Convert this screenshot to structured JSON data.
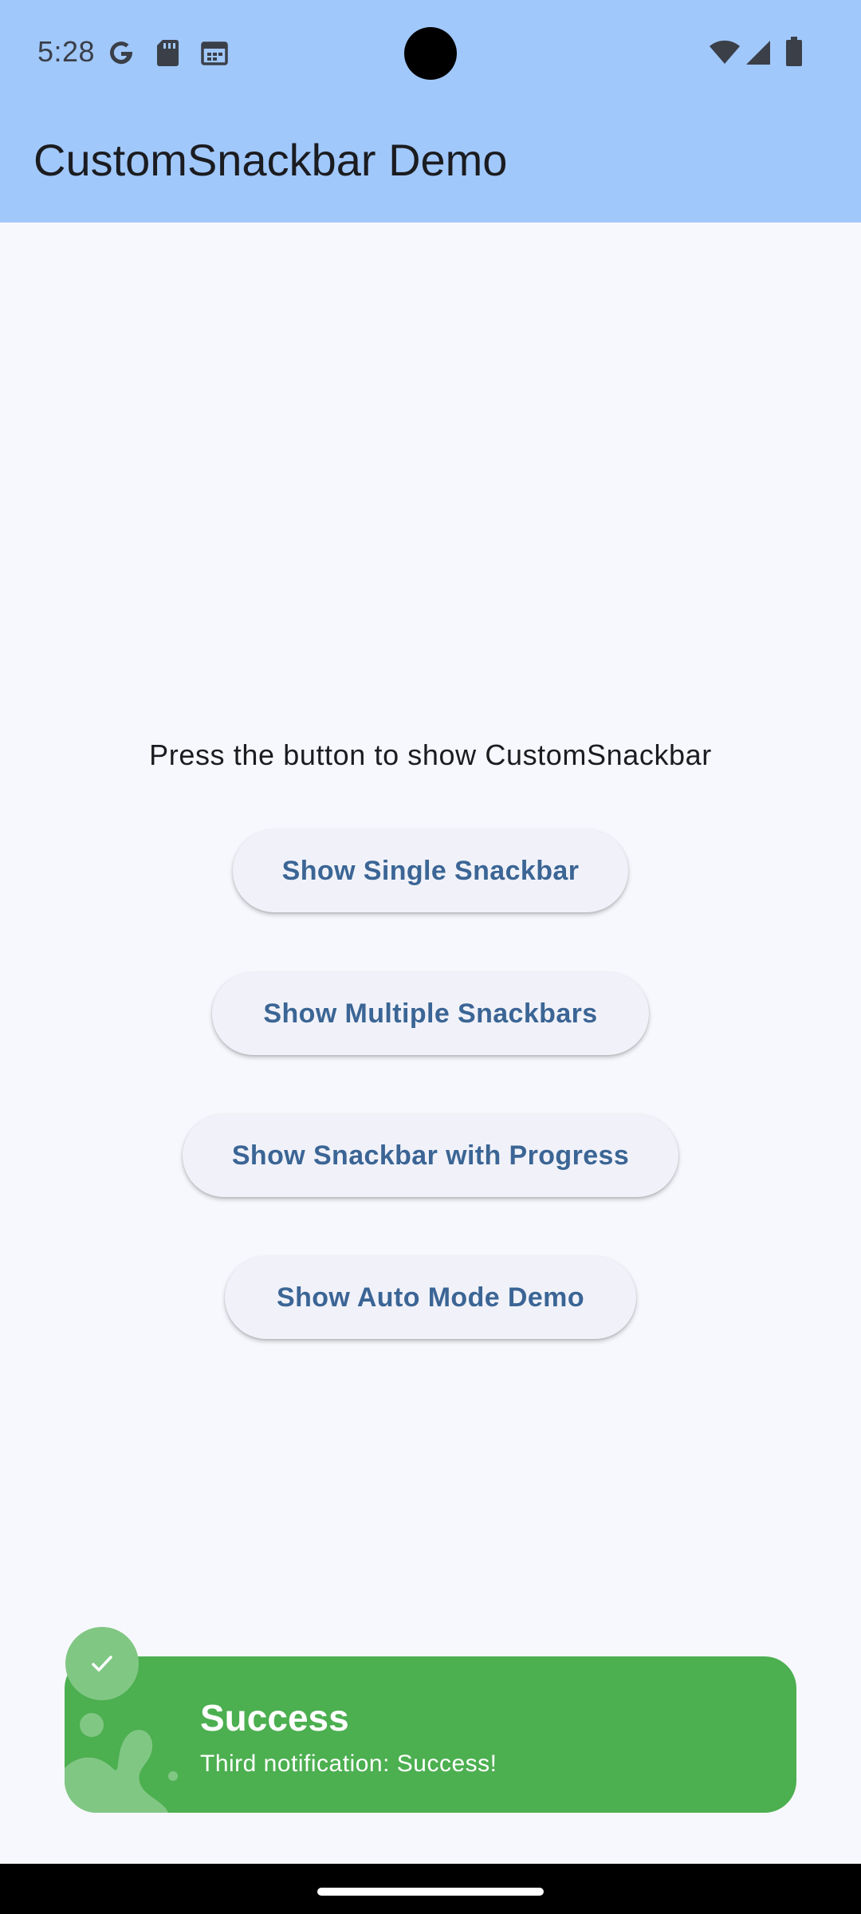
{
  "status_bar": {
    "time": "5:28",
    "left_icons": [
      "google-icon",
      "sd-card-icon",
      "calendar-icon"
    ],
    "right_icons": [
      "wifi-icon",
      "cell-signal-icon",
      "battery-icon"
    ]
  },
  "app_bar": {
    "title": "CustomSnackbar Demo",
    "color": "#a1c8fb"
  },
  "main": {
    "prompt": "Press the button to show CustomSnackbar",
    "buttons": [
      {
        "label": "Show Single Snackbar"
      },
      {
        "label": "Show Multiple Snackbars"
      },
      {
        "label": "Show Snackbar with Progress"
      },
      {
        "label": "Show Auto Mode Demo"
      }
    ],
    "button_text_color": "#3b6595"
  },
  "snackbar": {
    "title": "Success",
    "message": "Third notification: Success!",
    "icon": "check-icon",
    "color": "#4caf50"
  }
}
